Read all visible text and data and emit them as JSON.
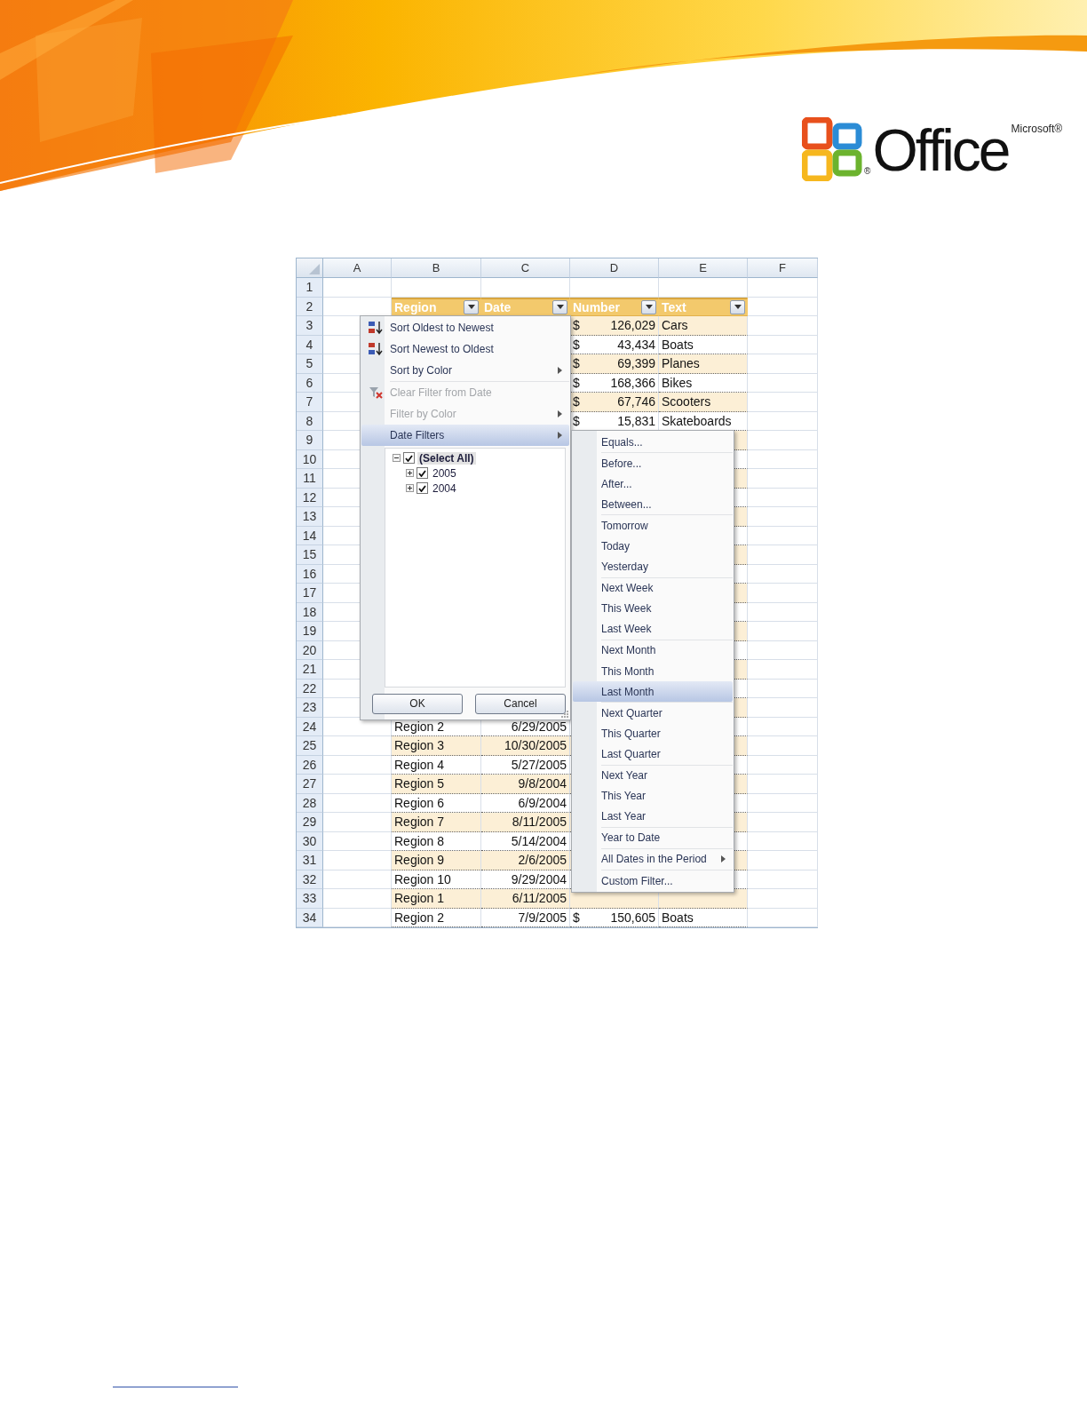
{
  "header": {
    "logo": {
      "brand": "Microsoft®",
      "product": "Office",
      "registered": "®"
    }
  },
  "sheet": {
    "columns": [
      "A",
      "B",
      "C",
      "D",
      "E",
      "F"
    ],
    "rows": [
      {
        "number": "1",
        "kind": "blank"
      },
      {
        "number": "2",
        "kind": "header",
        "headers": [
          {
            "label": "Region"
          },
          {
            "label": "Date"
          },
          {
            "label": "Number"
          },
          {
            "label": "Text"
          }
        ]
      },
      {
        "number": "3",
        "kind": "data",
        "currency": "$",
        "amount": "126,029",
        "text": "Cars"
      },
      {
        "number": "4",
        "kind": "data",
        "currency": "$",
        "amount": "43,434",
        "text": "Boats"
      },
      {
        "number": "5",
        "kind": "data",
        "currency": "$",
        "amount": "69,399",
        "text": "Planes"
      },
      {
        "number": "6",
        "kind": "data",
        "currency": "$",
        "amount": "168,366",
        "text": "Bikes"
      },
      {
        "number": "7",
        "kind": "data",
        "currency": "$",
        "amount": "67,746",
        "text": "Scooters"
      },
      {
        "number": "8",
        "kind": "data",
        "currency": "$",
        "amount": "15,831",
        "text": "Skateboards"
      },
      {
        "number": "9",
        "kind": "data"
      },
      {
        "number": "10",
        "kind": "data"
      },
      {
        "number": "11",
        "kind": "data"
      },
      {
        "number": "12",
        "kind": "data"
      },
      {
        "number": "13",
        "kind": "data"
      },
      {
        "number": "14",
        "kind": "data"
      },
      {
        "number": "15",
        "kind": "data"
      },
      {
        "number": "16",
        "kind": "data"
      },
      {
        "number": "17",
        "kind": "data"
      },
      {
        "number": "18",
        "kind": "data"
      },
      {
        "number": "19",
        "kind": "data"
      },
      {
        "number": "20",
        "kind": "data"
      },
      {
        "number": "21",
        "kind": "data"
      },
      {
        "number": "22",
        "kind": "data"
      },
      {
        "number": "23",
        "kind": "data"
      },
      {
        "number": "24",
        "kind": "data",
        "region": "Region 2",
        "date": "6/29/2005"
      },
      {
        "number": "25",
        "kind": "data",
        "region": "Region 3",
        "date": "10/30/2005"
      },
      {
        "number": "26",
        "kind": "data",
        "region": "Region 4",
        "date": "5/27/2005"
      },
      {
        "number": "27",
        "kind": "data",
        "region": "Region 5",
        "date": "9/8/2004"
      },
      {
        "number": "28",
        "kind": "data",
        "region": "Region 6",
        "date": "6/9/2004"
      },
      {
        "number": "29",
        "kind": "data",
        "region": "Region 7",
        "date": "8/11/2005"
      },
      {
        "number": "30",
        "kind": "data",
        "region": "Region 8",
        "date": "5/14/2004"
      },
      {
        "number": "31",
        "kind": "data",
        "region": "Region 9",
        "date": "2/6/2005"
      },
      {
        "number": "32",
        "kind": "data",
        "region": "Region 10",
        "date": "9/29/2004"
      },
      {
        "number": "33",
        "kind": "data",
        "region": "Region 1",
        "date": "6/11/2005"
      },
      {
        "number": "34",
        "kind": "data",
        "region": "Region 2",
        "date": "7/9/2005",
        "currency": "$",
        "amount": "150,605",
        "text": "Boats"
      }
    ]
  },
  "filter_menu": {
    "groups": [
      [
        {
          "label": "Sort Oldest to Newest",
          "kind": "sort-asc",
          "selected": false,
          "disabled": false,
          "submenu": false
        },
        {
          "label": "Sort Newest to Oldest",
          "kind": "sort-desc",
          "selected": false,
          "disabled": false,
          "submenu": false
        },
        {
          "label": "Sort by Color",
          "kind": "plain",
          "selected": false,
          "disabled": false,
          "submenu": true
        }
      ],
      [
        {
          "label": "Clear Filter from Date",
          "kind": "clear-filter",
          "selected": false,
          "disabled": true,
          "submenu": false
        },
        {
          "label": "Filter by Color",
          "kind": "plain",
          "selected": false,
          "disabled": true,
          "submenu": true
        },
        {
          "label": "Date Filters",
          "kind": "plain",
          "selected": true,
          "disabled": false,
          "submenu": true
        }
      ]
    ],
    "tree": [
      {
        "label": "(Select All)",
        "checked": true,
        "expanded": true,
        "children": [
          {
            "label": "2005",
            "checked": true,
            "expanded": false
          },
          {
            "label": "2004",
            "checked": true,
            "expanded": false
          }
        ]
      }
    ],
    "buttons": [
      "OK",
      "Cancel"
    ]
  },
  "date_filters_menu": {
    "groups": [
      [
        {
          "label": "Equals...",
          "selected": false,
          "submenu": false
        }
      ],
      [
        {
          "label": "Before...",
          "selected": false,
          "submenu": false
        },
        {
          "label": "After...",
          "selected": false,
          "submenu": false
        },
        {
          "label": "Between...",
          "selected": false,
          "submenu": false
        }
      ],
      [
        {
          "label": "Tomorrow",
          "selected": false,
          "submenu": false
        },
        {
          "label": "Today",
          "selected": false,
          "submenu": false
        },
        {
          "label": "Yesterday",
          "selected": false,
          "submenu": false
        }
      ],
      [
        {
          "label": "Next Week",
          "selected": false,
          "submenu": false
        },
        {
          "label": "This Week",
          "selected": false,
          "submenu": false
        },
        {
          "label": "Last Week",
          "selected": false,
          "submenu": false
        }
      ],
      [
        {
          "label": "Next Month",
          "selected": false,
          "submenu": false
        },
        {
          "label": "This Month",
          "selected": false,
          "submenu": false
        },
        {
          "label": "Last Month",
          "selected": true,
          "submenu": false
        }
      ],
      [
        {
          "label": "Next Quarter",
          "selected": false,
          "submenu": false
        },
        {
          "label": "This Quarter",
          "selected": false,
          "submenu": false
        },
        {
          "label": "Last Quarter",
          "selected": false,
          "submenu": false
        }
      ],
      [
        {
          "label": "Next Year",
          "selected": false,
          "submenu": false
        },
        {
          "label": "This Year",
          "selected": false,
          "submenu": false
        },
        {
          "label": "Last Year",
          "selected": false,
          "submenu": false
        }
      ],
      [
        {
          "label": "Year to Date",
          "selected": false,
          "submenu": false
        }
      ],
      [
        {
          "label": "All Dates in the Period",
          "selected": false,
          "submenu": true
        }
      ],
      [
        {
          "label": "Custom Filter...",
          "selected": false,
          "submenu": false
        }
      ]
    ]
  }
}
